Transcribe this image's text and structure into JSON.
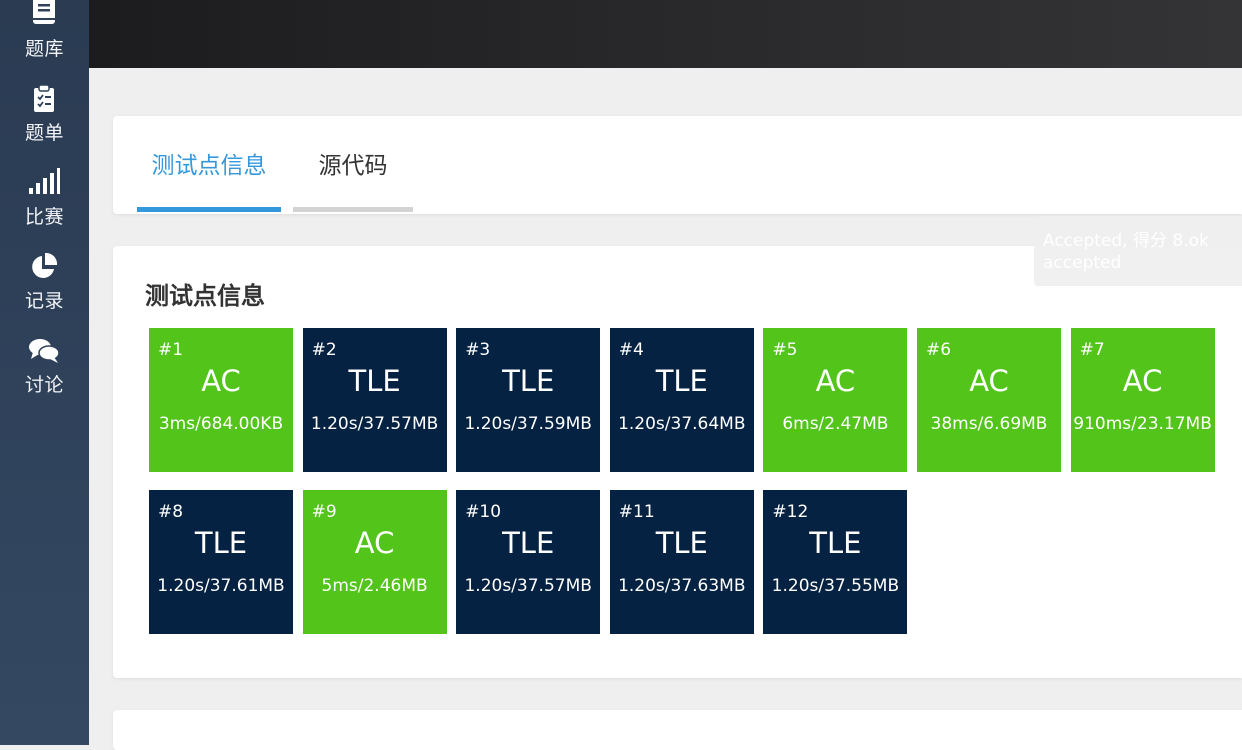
{
  "sidebar": {
    "items": [
      {
        "label": "题库",
        "icon": "book-icon"
      },
      {
        "label": "题单",
        "icon": "clipboard-list-icon"
      },
      {
        "label": "比赛",
        "icon": "signal-bars-icon"
      },
      {
        "label": "记录",
        "icon": "pie-chart-icon"
      },
      {
        "label": "讨论",
        "icon": "comments-icon"
      }
    ]
  },
  "tabs": [
    {
      "label": "测试点信息",
      "active": true
    },
    {
      "label": "源代码",
      "active": false
    }
  ],
  "toast": {
    "line1": "Accepted, 得分 8.ok",
    "line2": "accepted"
  },
  "testcases": {
    "title": "测试点信息",
    "items": [
      {
        "id": "#1",
        "verdict": "AC",
        "stats": "3ms/684.00KB"
      },
      {
        "id": "#2",
        "verdict": "TLE",
        "stats": "1.20s/37.57MB"
      },
      {
        "id": "#3",
        "verdict": "TLE",
        "stats": "1.20s/37.59MB"
      },
      {
        "id": "#4",
        "verdict": "TLE",
        "stats": "1.20s/37.64MB"
      },
      {
        "id": "#5",
        "verdict": "AC",
        "stats": "6ms/2.47MB"
      },
      {
        "id": "#6",
        "verdict": "AC",
        "stats": "38ms/6.69MB"
      },
      {
        "id": "#7",
        "verdict": "AC",
        "stats": "910ms/23.17MB"
      },
      {
        "id": "#8",
        "verdict": "TLE",
        "stats": "1.20s/37.61MB"
      },
      {
        "id": "#9",
        "verdict": "AC",
        "stats": "5ms/2.46MB"
      },
      {
        "id": "#10",
        "verdict": "TLE",
        "stats": "1.20s/37.57MB"
      },
      {
        "id": "#11",
        "verdict": "TLE",
        "stats": "1.20s/37.63MB"
      },
      {
        "id": "#12",
        "verdict": "TLE",
        "stats": "1.20s/37.55MB"
      }
    ]
  },
  "colors": {
    "ac": "#52c41a",
    "tle": "#052242",
    "tab_active": "#3498db",
    "tab_inactive_bar": "#d3d3d3"
  }
}
